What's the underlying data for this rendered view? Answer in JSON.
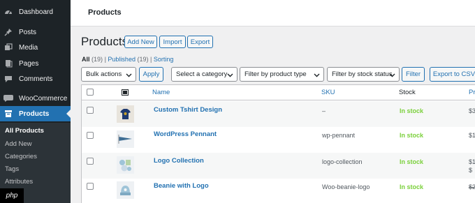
{
  "sidebar": {
    "items": [
      {
        "label": "Dashboard",
        "icon": "dashboard-icon"
      },
      {
        "label": "Posts",
        "icon": "pin-icon"
      },
      {
        "label": "Media",
        "icon": "media-icon"
      },
      {
        "label": "Pages",
        "icon": "pages-icon"
      },
      {
        "label": "Comments",
        "icon": "comment-icon"
      },
      {
        "label": "WooCommerce",
        "icon": "woocommerce-icon"
      },
      {
        "label": "Products",
        "icon": "archive-icon"
      }
    ],
    "submenu": [
      "All Products",
      "Add New",
      "Categories",
      "Tags",
      "Attributes"
    ]
  },
  "topbar": {
    "title": "Products"
  },
  "page": {
    "title": "Products",
    "add_new": "Add New",
    "import": "Import",
    "export": "Export"
  },
  "views": {
    "all": "All",
    "all_count": "(19)",
    "published": "Published",
    "published_count": "(19)",
    "sorting": "Sorting",
    "sep": "|"
  },
  "tablenav": {
    "bulk_actions": "Bulk actions",
    "apply": "Apply",
    "category": "Select a category",
    "product_type": "Filter by product type",
    "stock_status": "Filter by stock status",
    "filter": "Filter",
    "export_csv": "Export to CSV"
  },
  "table": {
    "columns": {
      "name": "Name",
      "sku": "SKU",
      "stock": "Stock",
      "price": "Pri"
    },
    "rows": [
      {
        "name": "Custom Tshirt Design",
        "sku": "–",
        "stock": "In stock",
        "price": "$3"
      },
      {
        "name": "WordPress Pennant",
        "sku": "wp-pennant",
        "stock": "In stock",
        "price": "$1"
      },
      {
        "name": "Logo Collection",
        "sku": "logo-collection",
        "stock": "In stock",
        "price": "$1",
        "price2": "$"
      },
      {
        "name": "Beanie with Logo",
        "sku": "Woo-beanie-logo",
        "stock": "In stock",
        "price": "$2"
      }
    ]
  },
  "watermark": "php",
  "colors": {
    "accent": "#2271b1",
    "sidebar": "#1d2327",
    "in_stock": "#7ad03a"
  }
}
